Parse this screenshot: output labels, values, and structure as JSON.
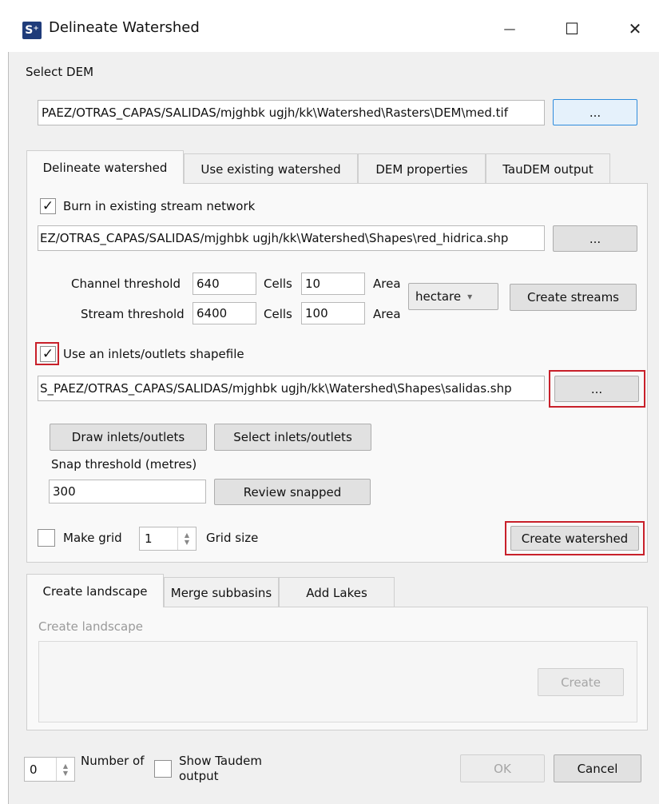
{
  "window": {
    "title": "Delineate Watershed",
    "app_icon_text": "S⁺",
    "controls": {
      "minimize": "—",
      "maximize": "☐",
      "close": "✕"
    }
  },
  "dem": {
    "label": "Select DEM",
    "path": "PAEZ/OTRAS_CAPAS/SALIDAS/mjghbk ugjh/kk\\Watershed\\Rasters\\DEM\\med.tif",
    "browse_label": "..."
  },
  "tabs": [
    "Delineate watershed",
    "Use existing watershed",
    "DEM properties",
    "TauDEM output"
  ],
  "delineate": {
    "burn_in": {
      "checked": "✓",
      "label": "Burn in existing stream network"
    },
    "stream_path": "EZ/OTRAS_CAPAS/SALIDAS/mjghbk ugjh/kk\\Watershed\\Shapes\\red_hidrica.shp",
    "stream_browse": "...",
    "channel_threshold": {
      "label": "Channel threshold",
      "cells_value": "640",
      "cells_label": "Cells",
      "area_value": "10",
      "area_label": "Area"
    },
    "stream_threshold": {
      "label": "Stream threshold",
      "cells_value": "6400",
      "cells_label": "Cells",
      "area_value": "100",
      "area_label": "Area"
    },
    "unit": {
      "value": "hectare",
      "arrow": "▾"
    },
    "create_streams": "Create streams",
    "inlets": {
      "checked": "✓",
      "label": "Use an inlets/outlets shapefile"
    },
    "inlets_path": "S_PAEZ/OTRAS_CAPAS/SALIDAS/mjghbk ugjh/kk\\Watershed\\Shapes\\salidas.shp",
    "inlets_browse": "...",
    "draw_inlets": "Draw inlets/outlets",
    "select_inlets": "Select inlets/outlets",
    "snap_label": "Snap threshold (metres)",
    "snap_value": "300",
    "review_snapped": "Review snapped",
    "make_grid_label": "Make grid",
    "grid_size_value": "1",
    "grid_size_label": "Grid size",
    "create_watershed": "Create watershed"
  },
  "lower_tabs": [
    "Create landscape",
    "Merge subbasins",
    "Add Lakes"
  ],
  "landscape": {
    "group_label": "Create landscape",
    "create_button": "Create"
  },
  "footer": {
    "number_value": "0",
    "number_label": "Number of",
    "show_taudem_label": "Show Taudem output",
    "ok": "OK",
    "cancel": "Cancel"
  }
}
